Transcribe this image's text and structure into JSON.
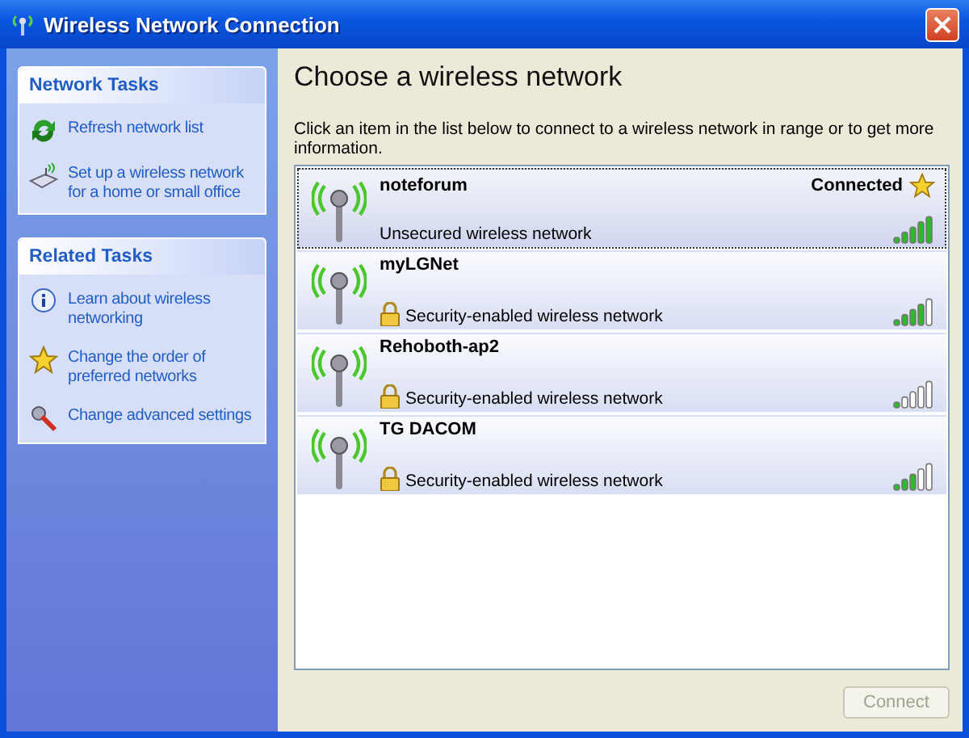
{
  "window": {
    "title": "Wireless Network Connection"
  },
  "task_panels": [
    {
      "title": "Network Tasks",
      "items": [
        {
          "kind": "refresh",
          "label": "Refresh network list"
        },
        {
          "kind": "setup",
          "label": "Set up a wireless network for a home or small office"
        }
      ]
    },
    {
      "title": "Related Tasks",
      "items": [
        {
          "kind": "info",
          "label": "Learn about wireless networking"
        },
        {
          "kind": "star",
          "label": "Change the order of preferred networks"
        },
        {
          "kind": "tools",
          "label": "Change advanced settings"
        }
      ]
    }
  ],
  "heading": "Choose a wireless network",
  "instructions": "Click an item in the list below to connect to a wireless network in range or to get more information.",
  "networks": [
    {
      "name": "noteforum",
      "status": "Connected",
      "preferred": true,
      "secured": false,
      "description": "Unsecured wireless network",
      "level": 1,
      "selected": true
    },
    {
      "name": "myLGNet",
      "preferred": false,
      "secured": true,
      "description": "Security-enabled wireless network",
      "level": 0.8,
      "selected": false
    },
    {
      "name": "Rehoboth-ap2",
      "preferred": false,
      "secured": true,
      "description": "Security-enabled wireless network",
      "level": 0.2,
      "selected": false
    },
    {
      "name": "TG DACOM",
      "preferred": false,
      "secured": true,
      "description": "Security-enabled wireless network",
      "level": 0.6,
      "selected": false
    }
  ],
  "connect_button": {
    "label": "Connect",
    "disabled": true
  }
}
